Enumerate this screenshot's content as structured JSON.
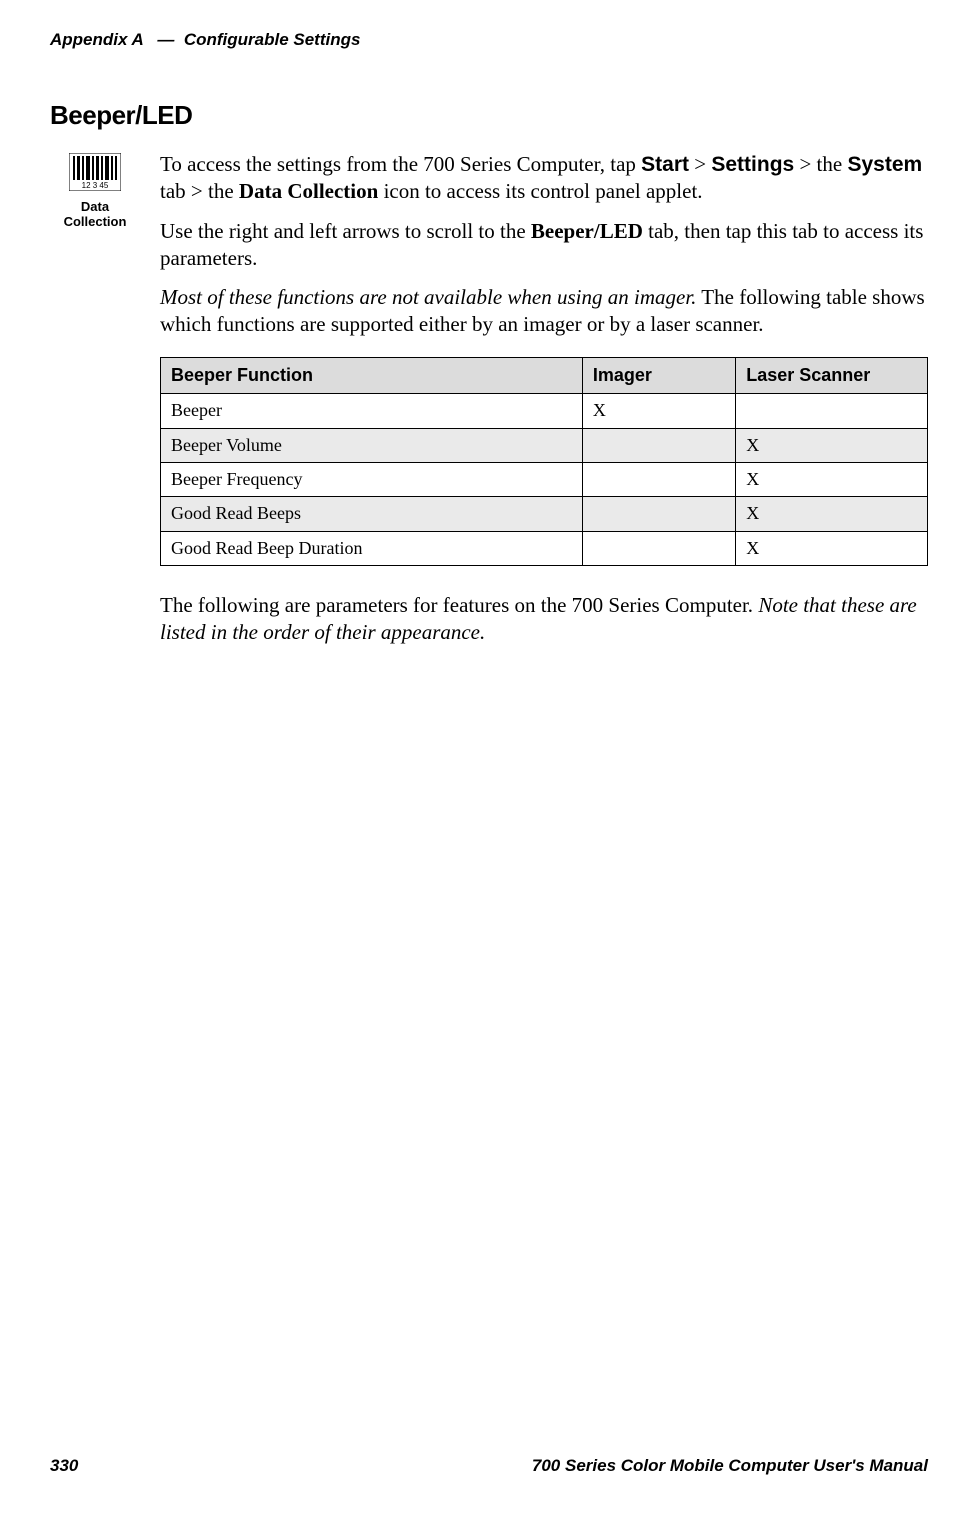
{
  "header": {
    "appendix": "Appendix",
    "letter": "A",
    "dash": "—",
    "title": "Configurable Settings"
  },
  "section_title": "Beeper/LED",
  "icon": {
    "label_line1": "Data",
    "label_line2": "Collection"
  },
  "para1": {
    "t1": "To access the settings from the 700 Series Computer, tap ",
    "start": "Start",
    "gt1": " > ",
    "settings": "Settings",
    "gt2": " > the ",
    "system": "System",
    "t2": " tab > the ",
    "datacol": "Data Collection",
    "t3": " icon to access its control panel applet."
  },
  "para2": {
    "t1": "Use the right and left arrows to scroll to the ",
    "beeper": "Beeper/LED",
    "t2": " tab, then tap this tab to access its parameters."
  },
  "para3": {
    "italic": "Most of these functions are not available when using an imager.",
    "rest": " The following table shows which functions are supported either by an imager or by a laser scanner."
  },
  "table": {
    "headers": {
      "func": "Beeper Function",
      "imager": "Imager",
      "laser": "Laser Scanner"
    },
    "rows": [
      {
        "func": "Beeper",
        "imager": "X",
        "laser": ""
      },
      {
        "func": "Beeper Volume",
        "imager": "",
        "laser": "X"
      },
      {
        "func": "Beeper Frequency",
        "imager": "",
        "laser": "X"
      },
      {
        "func": "Good Read Beeps",
        "imager": "",
        "laser": "X"
      },
      {
        "func": "Good Read Beep Duration",
        "imager": "",
        "laser": "X"
      }
    ]
  },
  "para4": {
    "t1": "The following are parameters for features on the 700 Series Computer. ",
    "italic": "Note that these are listed in the order of their appearance."
  },
  "footer": {
    "page": "330",
    "title": "700 Series Color Mobile Computer User's Manual"
  }
}
